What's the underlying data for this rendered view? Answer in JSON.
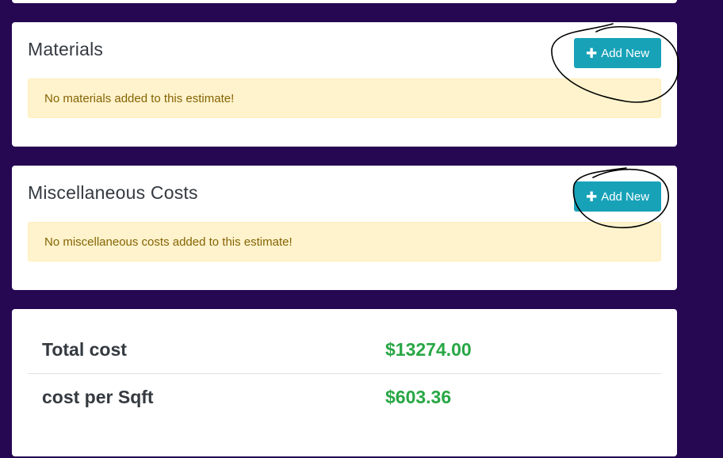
{
  "materials": {
    "title": "Materials",
    "add_button_label": "Add New",
    "empty_message": "No materials added to this estimate!"
  },
  "misc": {
    "title": "Miscellaneous Costs",
    "add_button_label": "Add New",
    "empty_message": "No miscellaneous costs added to this estimate!"
  },
  "summary": {
    "rows": [
      {
        "label": "Total cost",
        "value": "$13274.00"
      },
      {
        "label": "cost per Sqft",
        "value": "$603.36"
      }
    ]
  },
  "icons": {
    "add": "plus-icon"
  },
  "colors": {
    "background": "#260752",
    "button": "#17a2b8",
    "alert_bg": "#fff3cd",
    "alert_text": "#856404",
    "value_text": "#28a745"
  }
}
